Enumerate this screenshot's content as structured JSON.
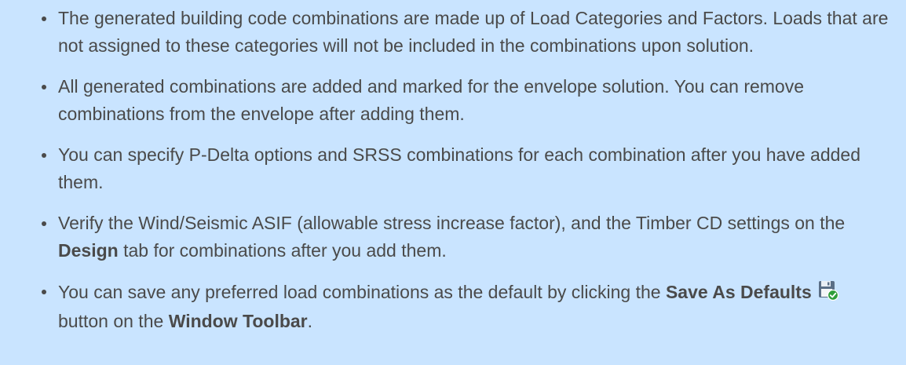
{
  "bullets": {
    "b1": "The generated building code combinations are made up of Load Categories and Factors. Loads that are not assigned to these categories will not be included in the combinations upon solution.",
    "b2": "All generated combinations are added and marked for the envelope solution. You can remove combinations from the envelope after adding them.",
    "b3": "You can specify P-Delta options and SRSS combinations for each combination after you have added them.",
    "b4": {
      "before": "Verify the Wind/Seismic ASIF (allowable stress increase factor), and the Timber CD settings on the ",
      "design": "Design",
      "after": " tab for combinations after you add them."
    },
    "b5": {
      "before": "You can save any preferred load combinations as the default by clicking the ",
      "save_as_defaults": "Save As Defaults",
      "middle": " button on the ",
      "window_toolbar": "Window Toolbar",
      "end": "."
    }
  },
  "icons": {
    "save_as_defaults": "save-as-defaults-icon"
  },
  "colors": {
    "background": "#c9e4ff",
    "text": "#4a4a4a"
  }
}
